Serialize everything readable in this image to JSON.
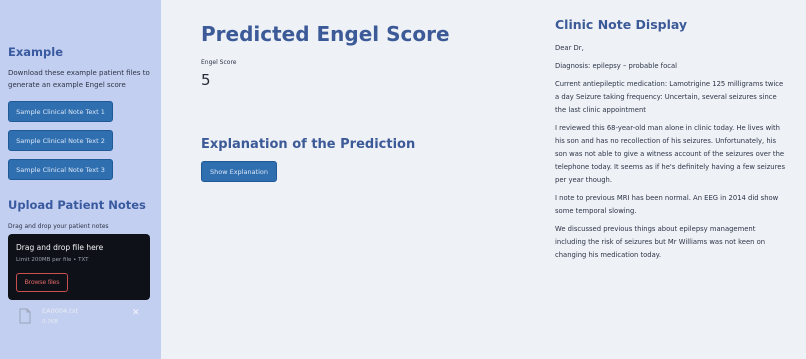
{
  "sidebar": {
    "example_heading": "Example",
    "example_text": "Download these example patient files to generate an example Engel score",
    "sample_buttons": [
      "Sample Clinical Note Text 1",
      "Sample Clinical Note Text 2",
      "Sample Clinical Note Text 3"
    ],
    "upload_heading": "Upload Patient Notes",
    "upload_subtext": "Drag and drop your patient notes",
    "dropzone": {
      "title": "Drag and drop file here",
      "limit": "Limit 200MB per file • TXT",
      "browse_label": "Browse files"
    },
    "file": {
      "name": "EA0004.txt",
      "size": "0.7KB",
      "icon": "file-icon",
      "close_icon": "close-icon"
    }
  },
  "main": {
    "title": "Predicted Engel Score",
    "score_label": "Engel Score",
    "score_value": "5",
    "explanation_title": "Explanation of the Prediction",
    "show_button": "Show Explanation"
  },
  "note": {
    "title": "Clinic Note Display",
    "paragraphs": [
      "Dear Dr,",
      "Diagnosis: epilepsy – probable focal",
      "Current antiepileptic medication: Lamotrigine 125 milligrams twice a day Seizure taking frequency: Uncertain, several seizures since the last clinic appointment",
      "I reviewed this 68-year-old man alone in clinic today. He lives with his son and has no recollection of his seizures. Unfortunately, his son was not able to give a witness account of the seizures over the telephone today. It seems as if he's definitely having a few seizures per year though.",
      "I note to previous MRI has been normal. An EEG in 2014 did show some temporal slowing.",
      "We discussed previous things about epilepsy management including the risk of seizures but Mr Williams was not keen on changing his medication today."
    ]
  },
  "colors": {
    "sidebar_bg": "#c3cff0",
    "main_bg": "#eef1f6",
    "heading": "#3c5a97",
    "button_bg": "#2f6fb0",
    "dropzone_bg": "#0e1117",
    "browse_accent": "#e46a68"
  }
}
